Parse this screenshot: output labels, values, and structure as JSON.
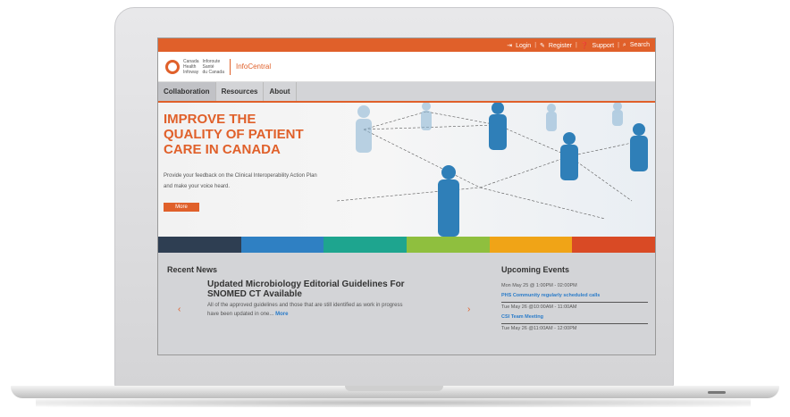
{
  "topbar": {
    "login": "Login",
    "register": "Register",
    "support": "Support",
    "search": "Search"
  },
  "brand": {
    "logo_en": [
      "Canada",
      "Health",
      "Infoway"
    ],
    "logo_fr": [
      "Inforoute",
      "Santé",
      "du Canada"
    ],
    "site_name": "InfoCentral"
  },
  "nav": {
    "items": [
      "Collaboration",
      "Resources",
      "About"
    ]
  },
  "hero": {
    "heading_lines": [
      "IMPROVE THE",
      "QUALITY OF PATIENT",
      "CARE IN CANADA"
    ],
    "text": "Provide your feedback on the Clinical Interoperability Action Plan and make your voice heard.",
    "more_label": "More"
  },
  "colorbar": [
    "#2e3e52",
    "#2f80c3",
    "#1ea58f",
    "#8fbf3e",
    "#f0a417",
    "#d94a25"
  ],
  "news": {
    "section_title": "Recent News",
    "headline": "Updated Microbiology Editorial Guidelines For SNOMED CT Available",
    "body": "All of the approved guidelines and those that are still identified as work in progress have been updated in one...",
    "more_link": "More",
    "prev": "‹",
    "next": "›"
  },
  "events": {
    "section_title": "Upcoming Events",
    "items": [
      {
        "time": "Mon May 25 @ 1:00PM - 02:00PM",
        "title": "PHS Community regularly scheduled calls"
      },
      {
        "time": "Tue May 26 @10:00AM - 11:00AM",
        "title": "CSI Team Meeting"
      },
      {
        "time": "Tue May 26 @11:00AM - 12:00PM",
        "title": ""
      }
    ]
  },
  "colors": {
    "accent": "#e0602a",
    "link": "#2b7cc9",
    "nav_bg": "#d3d4d7"
  }
}
